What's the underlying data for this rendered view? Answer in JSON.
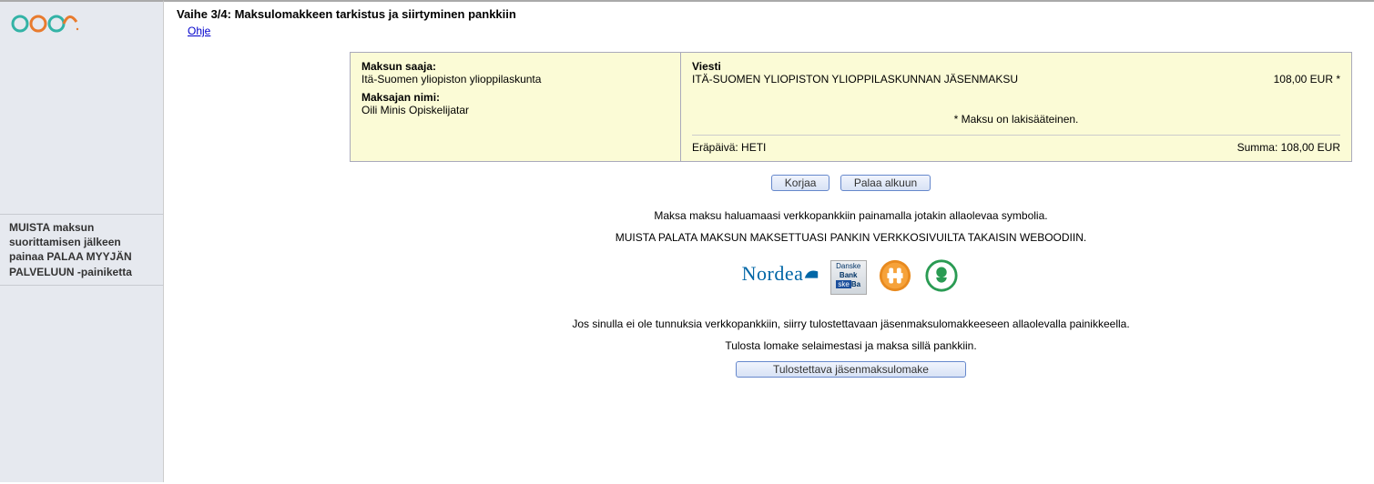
{
  "sidebar": {
    "note_line1": "MUISTA maksun suorittamisen jälkeen painaa PALAA MYYJÄN PALVELUUN -painiketta"
  },
  "page": {
    "title": "Vaihe 3/4: Maksulomakkeen tarkistus ja siirtyminen pankkiin",
    "help_link": "Ohje"
  },
  "payment": {
    "recipient_label": "Maksun saaja:",
    "recipient_value": "Itä-Suomen yliopiston ylioppilaskunta",
    "payer_label": "Maksajan nimi:",
    "payer_value": "Oili Minis Opiskelijatar",
    "message_label": "Viesti",
    "message_value": "ITÄ-SUOMEN YLIOPISTON YLIOPPILASKUNNAN JÄSENMAKSU",
    "line_amount": "108,00 EUR *",
    "statutory_note": "* Maksu on lakisääteinen.",
    "due_label": "Eräpäivä: HETI",
    "total_label": "Summa: 108,00 EUR"
  },
  "buttons": {
    "korjaa": "Korjaa",
    "palaa_alkuun": "Palaa alkuun",
    "print_form": "Tulostettava jäsenmaksulomake"
  },
  "texts": {
    "pay_instruction": "Maksa maksu haluamaasi verkkopankkiin painamalla jotakin allaolevaa symbolia.",
    "remember_return": "MUISTA PALATA MAKSUN MAKSETTUASI PANKIN VERKKOSIVUILTA TAKAISIN WEBOODIIN.",
    "no_bank_ids": "Jos sinulla ei ole tunnuksia verkkopankkiin, siirry tulostettavaan jäsenmaksulomakkeeseen allaolevalla painikkeella.",
    "print_instruction": "Tulosta lomake selaimestasi ja maksa sillä pankkiin."
  },
  "banks": {
    "nordea": "Nordea",
    "danske": "Danske Bank",
    "op": "OP",
    "sp": "SP"
  }
}
